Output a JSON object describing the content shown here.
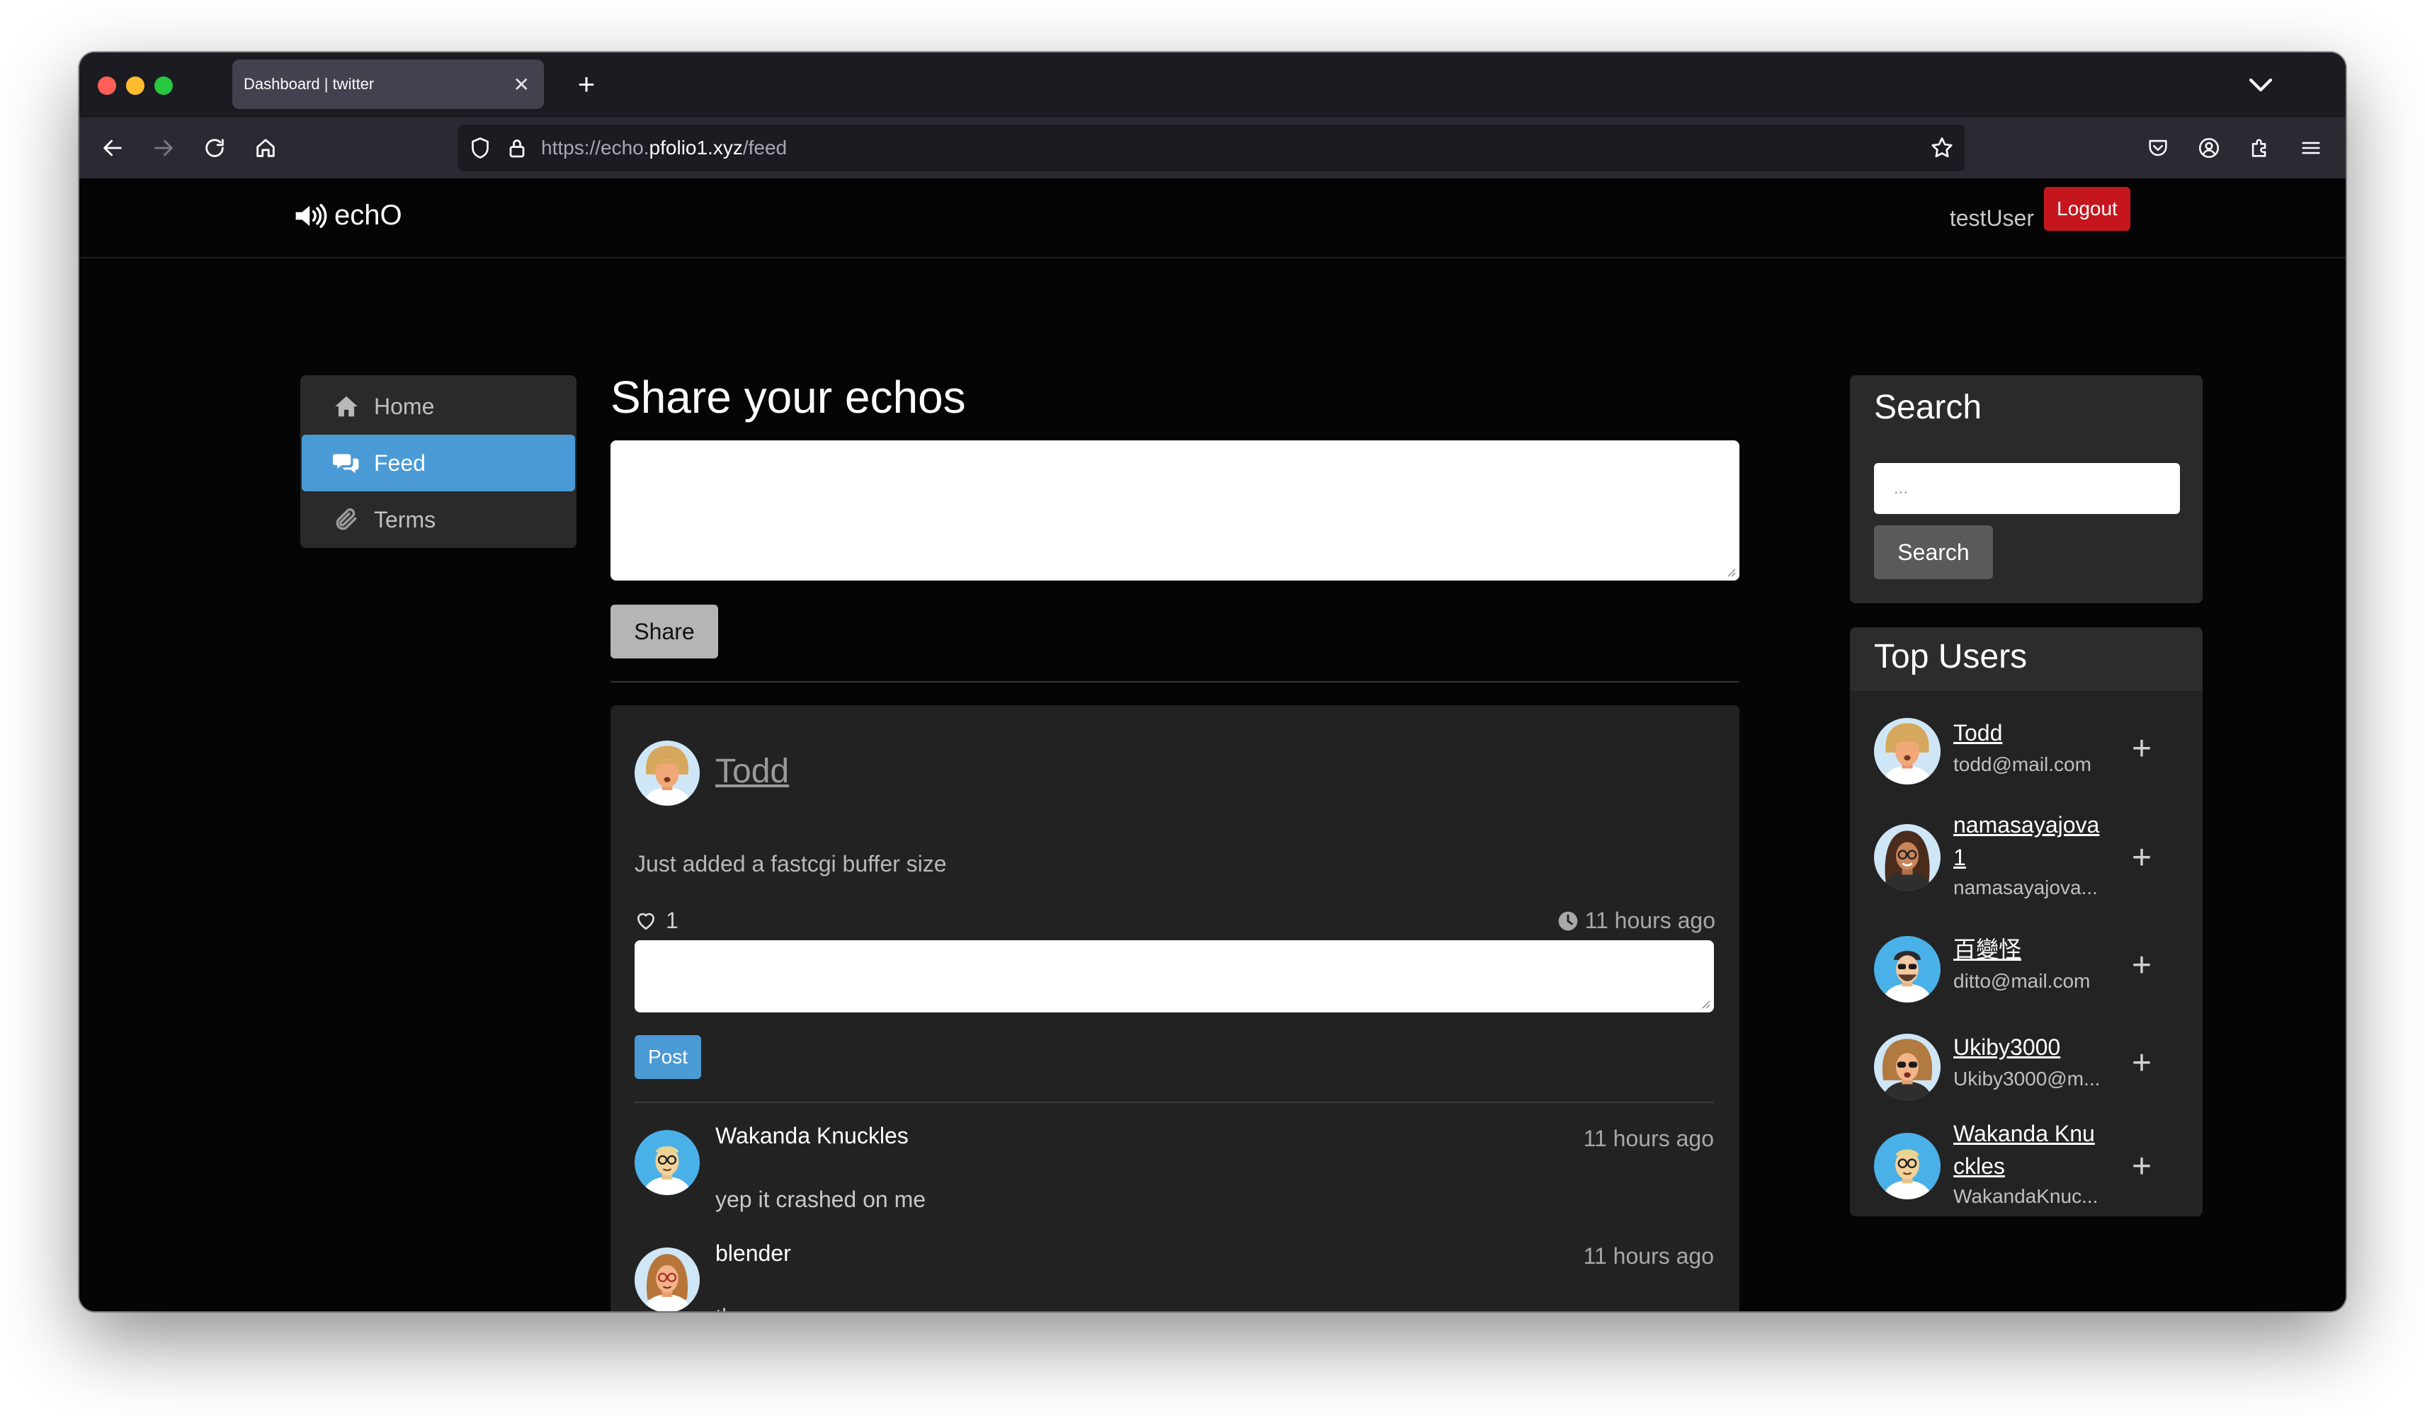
{
  "browser": {
    "tab_title": "Dashboard | twitter",
    "tab_close": "✕",
    "new_tab": "+",
    "url_prefix": "https://echo.",
    "url_host": "pfolio1.xyz",
    "url_path": "/feed"
  },
  "header": {
    "brand": "echO",
    "username": "testUser",
    "logout_label": "Logout"
  },
  "sidebar": {
    "items": [
      {
        "label": "Home",
        "icon": "home-icon"
      },
      {
        "label": "Feed",
        "icon": "comments-icon",
        "active": true
      },
      {
        "label": "Terms",
        "icon": "paperclip-icon"
      }
    ]
  },
  "compose": {
    "title": "Share your echos",
    "share_label": "Share"
  },
  "post": {
    "author": "Todd",
    "body": "Just added a fastcgi buffer size",
    "likes": "1",
    "time": "11 hours ago",
    "post_label": "Post",
    "comments": [
      {
        "name": "Wakanda Knuckles",
        "text": "yep it crashed on me",
        "time": "11 hours ago"
      },
      {
        "name": "blender",
        "text": "thx",
        "time": "11 hours ago"
      }
    ]
  },
  "search": {
    "title": "Search",
    "placeholder": "...",
    "button_label": "Search"
  },
  "top_users": {
    "title": "Top Users",
    "follow_symbol": "+",
    "users": [
      {
        "name": "Todd",
        "email": "todd@mail.com"
      },
      {
        "name": "namasayajova1",
        "email": "namasayajova..."
      },
      {
        "name": "百變怪",
        "email": "ditto@mail.com"
      },
      {
        "name": "Ukiby3000",
        "email": "Ukiby3000@m..."
      },
      {
        "name": "Wakanda Knuckles",
        "email": "WakandaKnuc..."
      }
    ]
  },
  "colors": {
    "accent": "#4a9ad6",
    "logout": "#c5161d",
    "page_bg": "#050505",
    "card_bg": "#222222"
  }
}
